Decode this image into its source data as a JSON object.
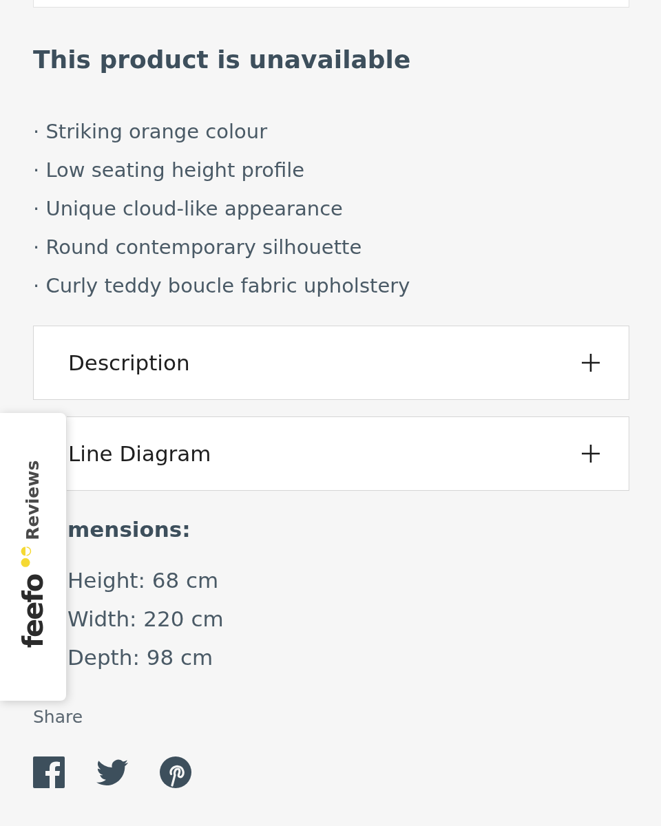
{
  "heading": "This product is unavailable",
  "features": [
    "· Striking orange colour",
    "· Low seating height profile",
    "· Unique cloud-like appearance",
    "· Round contemporary silhouette",
    "· Curly teddy boucle fabric upholstery"
  ],
  "accordions": [
    {
      "label": "Description",
      "expanded": false
    },
    {
      "label": "Line Diagram",
      "expanded": false
    }
  ],
  "dimensions": {
    "heading": "mensions:",
    "items": [
      "Height: 68 cm",
      "Width: 220 cm",
      "Depth: 98 cm"
    ]
  },
  "share": {
    "label": "Share",
    "links": [
      {
        "kind": "facebook"
      },
      {
        "kind": "twitter"
      },
      {
        "kind": "pinterest"
      }
    ]
  },
  "reviews_tab": {
    "logo": "feefo",
    "label": "Reviews"
  }
}
